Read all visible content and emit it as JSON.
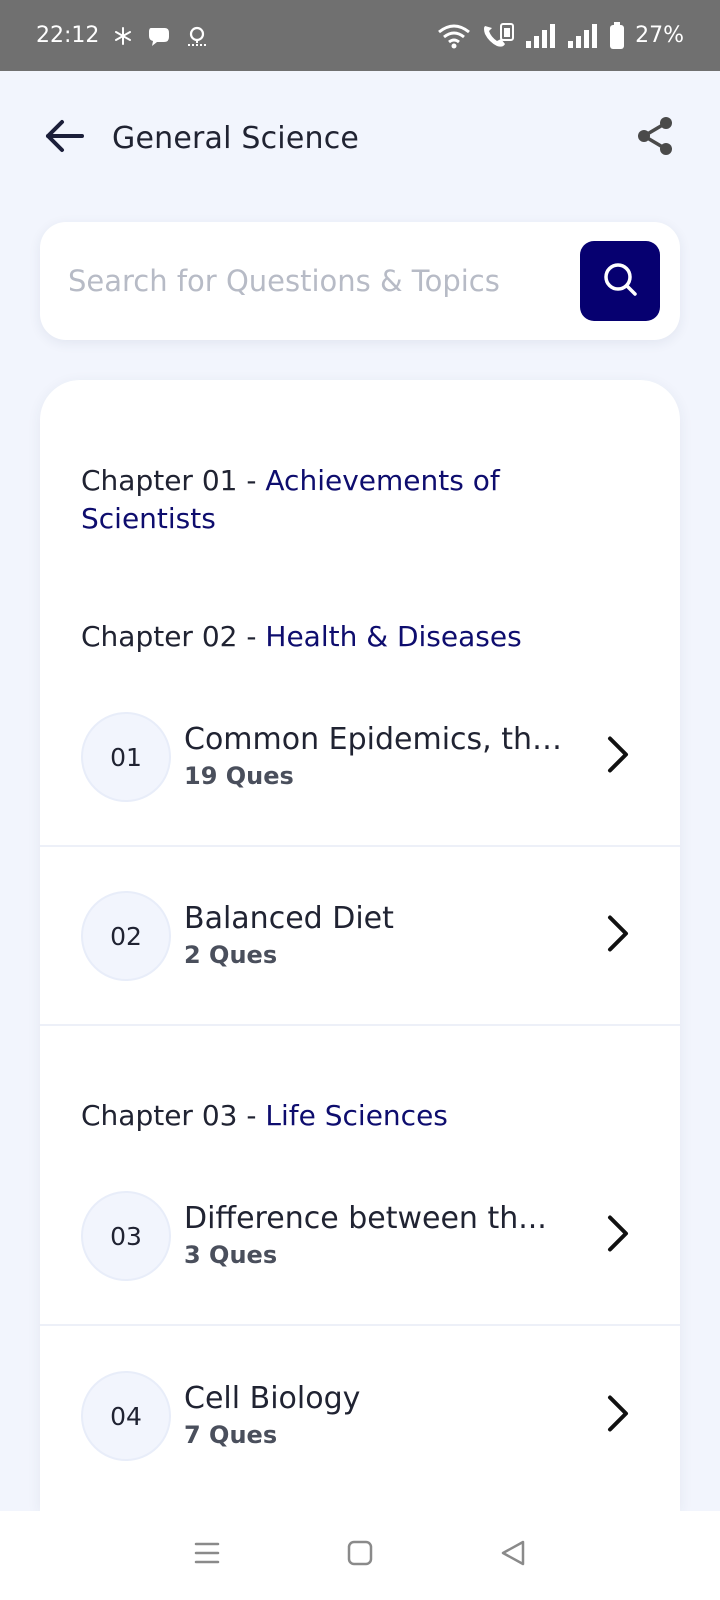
{
  "status_bar": {
    "time": "22:12",
    "battery": "27%",
    "icons": [
      "pinwheel-icon",
      "chat-bubble-icon",
      "voicemail-icon",
      "wifi-icon",
      "volte-call-icon",
      "signal-icon",
      "signal-icon",
      "battery-icon"
    ]
  },
  "header": {
    "title": "General Science",
    "back_icon": "arrow-left-icon",
    "share_icon": "share-icon"
  },
  "search": {
    "placeholder": "Search for Questions & Topics",
    "value": "",
    "icon": "search-icon"
  },
  "colors": {
    "accent": "#060070",
    "chapter_name": "#0e0d6e",
    "background": "#f2f5fd"
  },
  "chapters": [
    {
      "prefix": "Chapter 01 - ",
      "name": "Achievements of Scientists",
      "topics": []
    },
    {
      "prefix": "Chapter 02 - ",
      "name": "Health & Diseases",
      "topics": [
        {
          "number": "01",
          "title": "Common Epidemics, the...",
          "count": "19 Ques"
        },
        {
          "number": "02",
          "title": "Balanced Diet",
          "count": "2 Ques"
        }
      ]
    },
    {
      "prefix": "Chapter 03 - ",
      "name": "Life Sciences",
      "topics": [
        {
          "number": "03",
          "title": "Difference between th...",
          "count": "3 Ques"
        },
        {
          "number": "04",
          "title": "Cell Biology",
          "count": "7 Ques"
        }
      ]
    }
  ],
  "nav_bar": {
    "buttons": [
      "recent-apps-icon",
      "home-icon",
      "back-triangle-icon"
    ]
  }
}
